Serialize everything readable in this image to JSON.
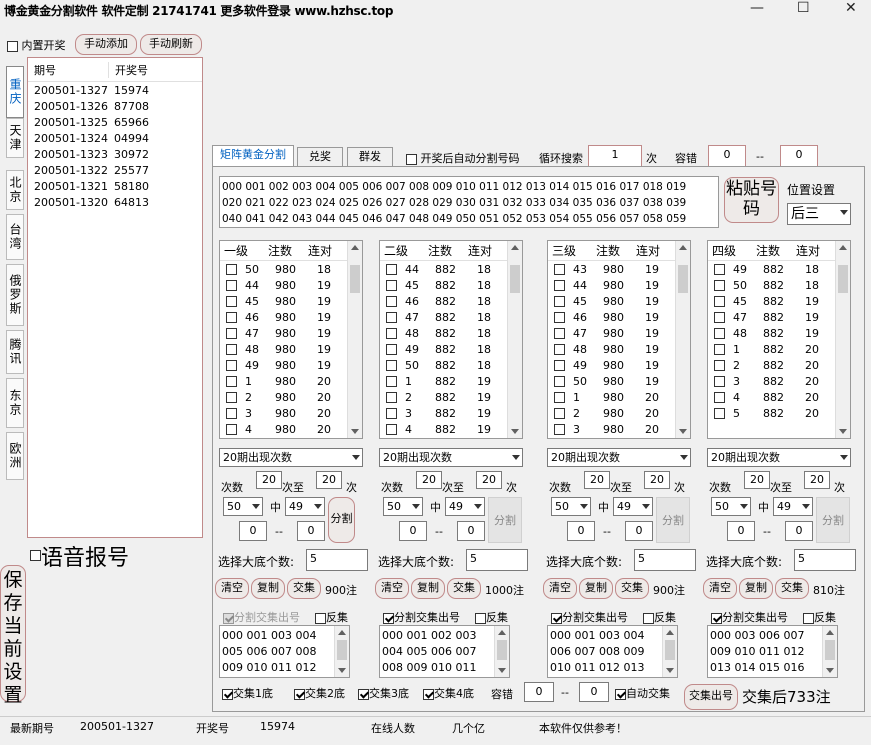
{
  "window": {
    "title": "博金黄金分割软件 软件定制 21741741 更多软件登录 www.hzhsc.top",
    "minimize": "—",
    "maximize": "☐",
    "close": "✕"
  },
  "top": {
    "builtin_label": "内置开奖",
    "manual_add": "手动添加",
    "manual_refresh": "手动刷新"
  },
  "side_tabs": [
    "重庆",
    "天津",
    "北京",
    "台湾",
    "俄罗斯",
    "腾讯",
    "东京",
    "欧洲"
  ],
  "draw_list": {
    "col_period": "期号",
    "col_number": "开奖号",
    "rows": [
      [
        "200501-1327",
        "15974"
      ],
      [
        "200501-1326",
        "87708"
      ],
      [
        "200501-1325",
        "65966"
      ],
      [
        "200501-1324",
        "04994"
      ],
      [
        "200501-1323",
        "30972"
      ],
      [
        "200501-1322",
        "25577"
      ],
      [
        "200501-1321",
        "58180"
      ],
      [
        "200501-1320",
        "64813"
      ]
    ]
  },
  "voice_label": "语音报号",
  "save_settings": "保存当前设置",
  "main_tabs": [
    "矩阵黄金分割",
    "兑奖",
    "群发"
  ],
  "auto_split_label": "开奖后自动分割号码",
  "loop_search_label": "循环搜索",
  "loop_search_value": "1",
  "loop_search_unit": "次",
  "tolerance_label": "容错",
  "tolerance_from": "0",
  "tolerance_to": "0",
  "dash": "--",
  "matrix_text": [
    "000 001 002 003 004 005 006 007 008 009 010 011 012 013 014 015 016 017 018 019",
    "020 021 022 023 024 025 026 027 028 029 030 031 032 033 034 035 036 037 038 039",
    "040 041 042 043 044 045 046 047 048 049 050 051 052 053 054 055 056 057 058 059"
  ],
  "paste_btn": "粘贴号码",
  "position_label": "位置设置",
  "position_value": "后三",
  "col_headers": {
    "zhu": "注数",
    "lian": "连对"
  },
  "levels": [
    {
      "name": "一级",
      "rows": [
        [
          "50",
          "980",
          "18"
        ],
        [
          "44",
          "980",
          "19"
        ],
        [
          "45",
          "980",
          "19"
        ],
        [
          "46",
          "980",
          "19"
        ],
        [
          "47",
          "980",
          "19"
        ],
        [
          "48",
          "980",
          "19"
        ],
        [
          "49",
          "980",
          "19"
        ],
        [
          "1",
          "980",
          "20"
        ],
        [
          "2",
          "980",
          "20"
        ],
        [
          "3",
          "980",
          "20"
        ],
        [
          "4",
          "980",
          "20"
        ]
      ],
      "period_select": "20期出现次数",
      "times_from": "20",
      "times_to": "20",
      "sel_a": "50",
      "sel_b": "49",
      "range_from": "0",
      "range_to": "0",
      "base_count": "5",
      "result_count": "900注",
      "cross_text": [
        "000 001 003 004",
        "005 006 007 008",
        "009 010 011 012"
      ]
    },
    {
      "name": "二级",
      "rows": [
        [
          "44",
          "882",
          "18"
        ],
        [
          "45",
          "882",
          "18"
        ],
        [
          "46",
          "882",
          "18"
        ],
        [
          "47",
          "882",
          "18"
        ],
        [
          "48",
          "882",
          "18"
        ],
        [
          "49",
          "882",
          "18"
        ],
        [
          "50",
          "882",
          "18"
        ],
        [
          "1",
          "882",
          "19"
        ],
        [
          "2",
          "882",
          "19"
        ],
        [
          "3",
          "882",
          "19"
        ],
        [
          "4",
          "882",
          "19"
        ]
      ],
      "period_select": "20期出现次数",
      "times_from": "20",
      "times_to": "20",
      "sel_a": "50",
      "sel_b": "49",
      "range_from": "0",
      "range_to": "0",
      "base_count": "5",
      "result_count": "1000注",
      "cross_text": [
        "000 001 002 003",
        "004 005 006 007",
        "008 009 010 011"
      ]
    },
    {
      "name": "三级",
      "rows": [
        [
          "43",
          "980",
          "19"
        ],
        [
          "44",
          "980",
          "19"
        ],
        [
          "45",
          "980",
          "19"
        ],
        [
          "46",
          "980",
          "19"
        ],
        [
          "47",
          "980",
          "19"
        ],
        [
          "48",
          "980",
          "19"
        ],
        [
          "49",
          "980",
          "19"
        ],
        [
          "50",
          "980",
          "19"
        ],
        [
          "1",
          "980",
          "20"
        ],
        [
          "2",
          "980",
          "20"
        ],
        [
          "3",
          "980",
          "20"
        ]
      ],
      "period_select": "20期出现次数",
      "times_from": "20",
      "times_to": "20",
      "sel_a": "50",
      "sel_b": "49",
      "range_from": "0",
      "range_to": "0",
      "base_count": "5",
      "result_count": "900注",
      "cross_text": [
        "000 001 003 004",
        "006 007 008 009",
        "010 011 012 013"
      ]
    },
    {
      "name": "四级",
      "rows": [
        [
          "49",
          "882",
          "18"
        ],
        [
          "50",
          "882",
          "18"
        ],
        [
          "45",
          "882",
          "19"
        ],
        [
          "47",
          "882",
          "19"
        ],
        [
          "48",
          "882",
          "19"
        ],
        [
          "1",
          "882",
          "20"
        ],
        [
          "2",
          "882",
          "20"
        ],
        [
          "3",
          "882",
          "20"
        ],
        [
          "4",
          "882",
          "20"
        ],
        [
          "5",
          "882",
          "20"
        ]
      ],
      "period_select": "20期出现次数",
      "times_from": "20",
      "times_to": "20",
      "sel_a": "50",
      "sel_b": "49",
      "range_from": "0",
      "range_to": "0",
      "base_count": "5",
      "result_count": "810注",
      "cross_text": [
        "000 003 006 007",
        "009 010 011 012",
        "013 014 015 016"
      ]
    }
  ],
  "labels": {
    "times": "次数",
    "times_mid": "次至",
    "times_end": "次",
    "zhong": "中",
    "split": "分割",
    "choose_base": "选择大底个数:",
    "clear": "清空",
    "copy": "复制",
    "cross": "交集",
    "split_cross": "分割交集出号",
    "reverse": "反集"
  },
  "bottom": {
    "cross1": "交集1底",
    "cross2": "交集2底",
    "cross3": "交集3底",
    "cross4": "交集4底",
    "tolerance": "容错",
    "tol_from": "0",
    "tol_to": "0",
    "auto_cross": "自动交集",
    "cross_out": "交集出号",
    "result": "交集后733注"
  },
  "status": {
    "latest_label": "最新期号",
    "latest_value": "200501-1327",
    "draw_label": "开奖号",
    "draw_value": "15974",
    "online_label": "在线人数",
    "online_value": "几个亿",
    "notice": "本软件仅供参考！"
  }
}
